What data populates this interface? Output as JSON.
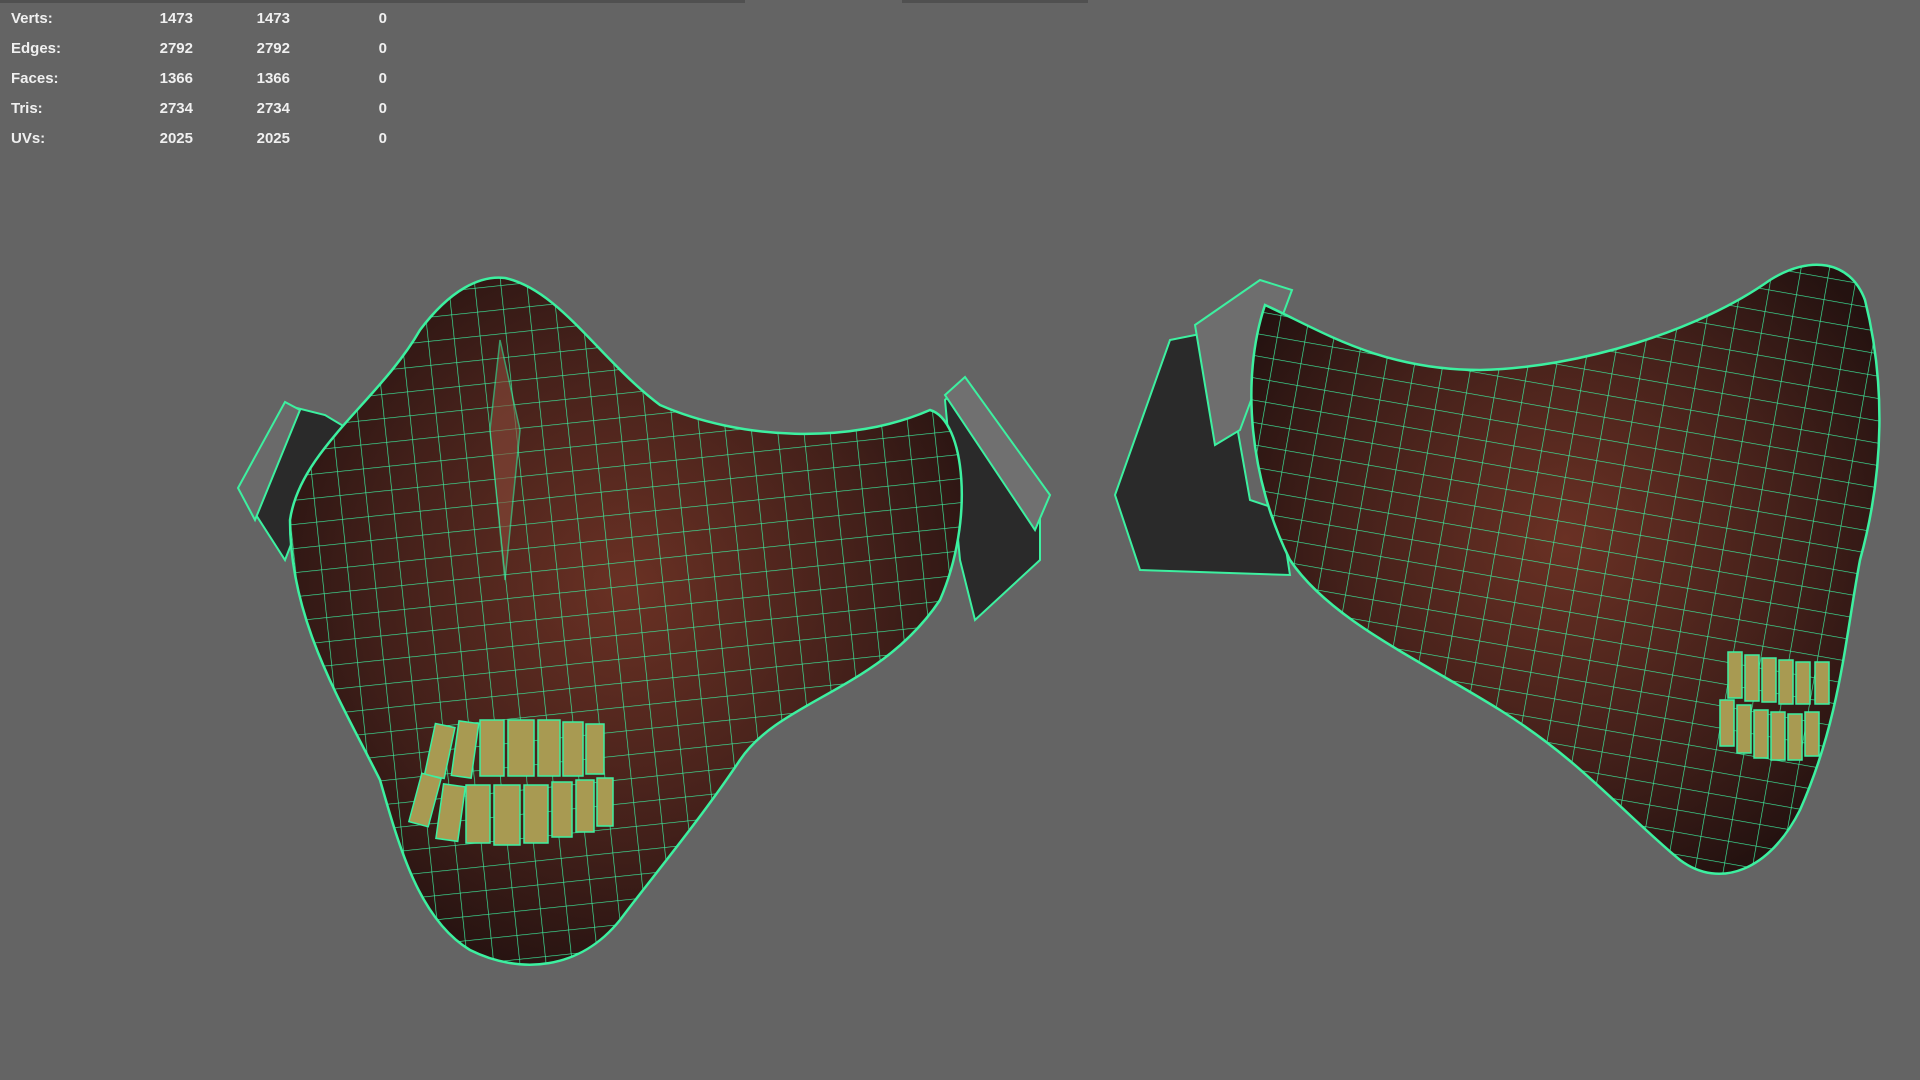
{
  "stats": [
    {
      "label": "Verts:",
      "a": "1473",
      "b": "1473",
      "c": "0"
    },
    {
      "label": "Edges:",
      "a": "2792",
      "b": "2792",
      "c": "0"
    },
    {
      "label": "Faces:",
      "a": "1366",
      "b": "1366",
      "c": "0"
    },
    {
      "label": "Tris:",
      "a": "2734",
      "b": "2734",
      "c": "0"
    },
    {
      "label": "UVs:",
      "a": "2025",
      "b": "2025",
      "c": "0"
    }
  ],
  "colors": {
    "background": "#646464",
    "wireframe": "#3df0a0",
    "mask": "#4a2118",
    "teeth": "#a89a52"
  }
}
